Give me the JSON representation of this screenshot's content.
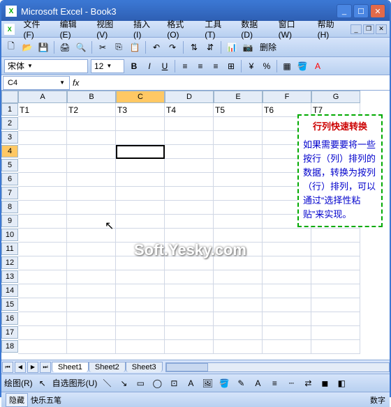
{
  "window": {
    "title": "Microsoft Excel - Book3"
  },
  "menu": {
    "file": "文件(F)",
    "edit": "编辑(E)",
    "view": "视图(V)",
    "insert": "插入(I)",
    "format": "格式(O)",
    "tools": "工具(T)",
    "data": "数据(D)",
    "window": "窗口(W)",
    "help": "帮助(H)"
  },
  "toolbar2_text": "删除",
  "font": {
    "name": "宋体",
    "size": "12"
  },
  "namebox": "C4",
  "fx_label": "fx",
  "columns": [
    "A",
    "B",
    "C",
    "D",
    "E",
    "F",
    "G"
  ],
  "rows": [
    "1",
    "2",
    "3",
    "4",
    "5",
    "6",
    "7",
    "8",
    "9",
    "10",
    "11",
    "12",
    "13",
    "14",
    "15",
    "16",
    "17",
    "18"
  ],
  "row1": {
    "A": "T1",
    "B": "T2",
    "C": "T3",
    "D": "T4",
    "E": "T5",
    "F": "T6",
    "G": "T7"
  },
  "active_cell": "C4",
  "tip": {
    "title": "行列快速转换",
    "body": "如果需要要将一些按行（列）排列的数据，转换为按列（行）排列，可以通过“选择性粘贴”来实现。"
  },
  "watermark": "Soft.Yesky.com",
  "tabs": {
    "nav": [
      "⏮",
      "◀",
      "▶",
      "⏭"
    ],
    "t1": "Sheet1",
    "t2": "Sheet2",
    "t3": "Sheet3"
  },
  "draw": {
    "label1": "绘图(R)",
    "label2": "自选图形(U)"
  },
  "status": {
    "ime_toggle": "隐藏",
    "ime": "快乐五笔",
    "right": "数字"
  }
}
